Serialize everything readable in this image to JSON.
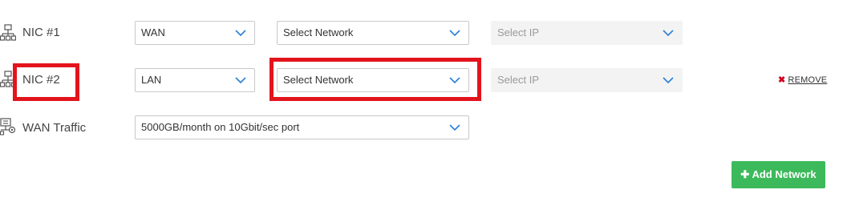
{
  "nics": [
    {
      "label": "NIC #1",
      "type_value": "WAN",
      "network_value": "Select Network",
      "ip_placeholder": "Select IP",
      "icon": "network-nodes-icon"
    },
    {
      "label": "NIC #2",
      "type_value": "LAN",
      "network_value": "Select Network",
      "ip_placeholder": "Select IP",
      "icon": "network-nodes-icon",
      "remove_label": "REMOVE"
    }
  ],
  "wan_traffic": {
    "label": "WAN Traffic",
    "value": "5000GB/month on 10Gbit/sec port",
    "icon": "traffic-settings-icon"
  },
  "actions": {
    "add_network_label": "Add Network",
    "add_icon": "plus-icon"
  },
  "colors": {
    "accent_blue": "#2a7fd4",
    "highlight_red": "#e3141c",
    "add_button_green": "#3cba5b",
    "remove_x_red": "#d0021b"
  }
}
